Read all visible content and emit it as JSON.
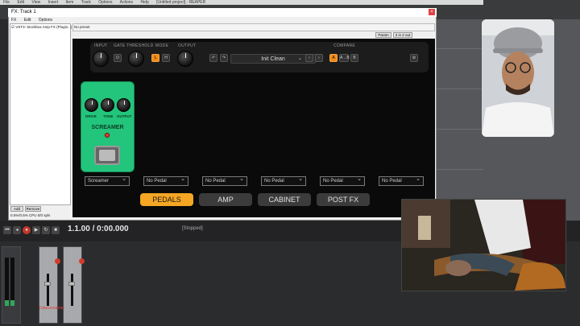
{
  "daw": {
    "menubar": [
      "File",
      "Edit",
      "View",
      "Insert",
      "Item",
      "Track",
      "Options",
      "Actions",
      "Help",
      "[Untitled project] - REAPER"
    ],
    "transport": {
      "timecode": "1.1.00 / 0:00.000",
      "status": "[Stopped]"
    },
    "mixer": {
      "track_label": "Tubescreamer"
    }
  },
  "fx_window": {
    "title": "FX: Track 1",
    "close": "×",
    "menu": [
      "FX",
      "Edit",
      "Options"
    ],
    "fx_list": [
      {
        "checked": true,
        "name": "VST3: Stockbox Amp FX (Plugin...)"
      }
    ],
    "buttons": {
      "add": "Add",
      "remove": "Remove"
    },
    "cpu": "0.5%/0.5% CPU 0/0 spls",
    "preset_label": "No preset",
    "param_button": "Param",
    "io_button": "2 in 2 out"
  },
  "plugin": {
    "header": {
      "labels": {
        "input": "INPUT",
        "gate": "GATE",
        "threshold": "THRESHOLD",
        "mode": "MODE",
        "output": "OUTPUT",
        "compare": "COMPARE"
      },
      "mode_buttons": [
        "L",
        "H"
      ],
      "compare_buttons": [
        "A",
        "A→B",
        "B"
      ],
      "preset_name": "Init Clean"
    },
    "pedal": {
      "name": "SCREAMER",
      "knobs": [
        "DRIVE",
        "TONE",
        "OUTPUT"
      ],
      "color": "#23c47b"
    },
    "slots": [
      "Screamer",
      "No Pedal",
      "No Pedal",
      "No Pedal",
      "No Pedal",
      "No Pedal"
    ],
    "tabs": [
      {
        "label": "PEDALS",
        "active": true
      },
      {
        "label": "AMP",
        "active": false
      },
      {
        "label": "CABINET",
        "active": false
      },
      {
        "label": "POST FX",
        "active": false
      }
    ],
    "accent": "#f5a623"
  }
}
